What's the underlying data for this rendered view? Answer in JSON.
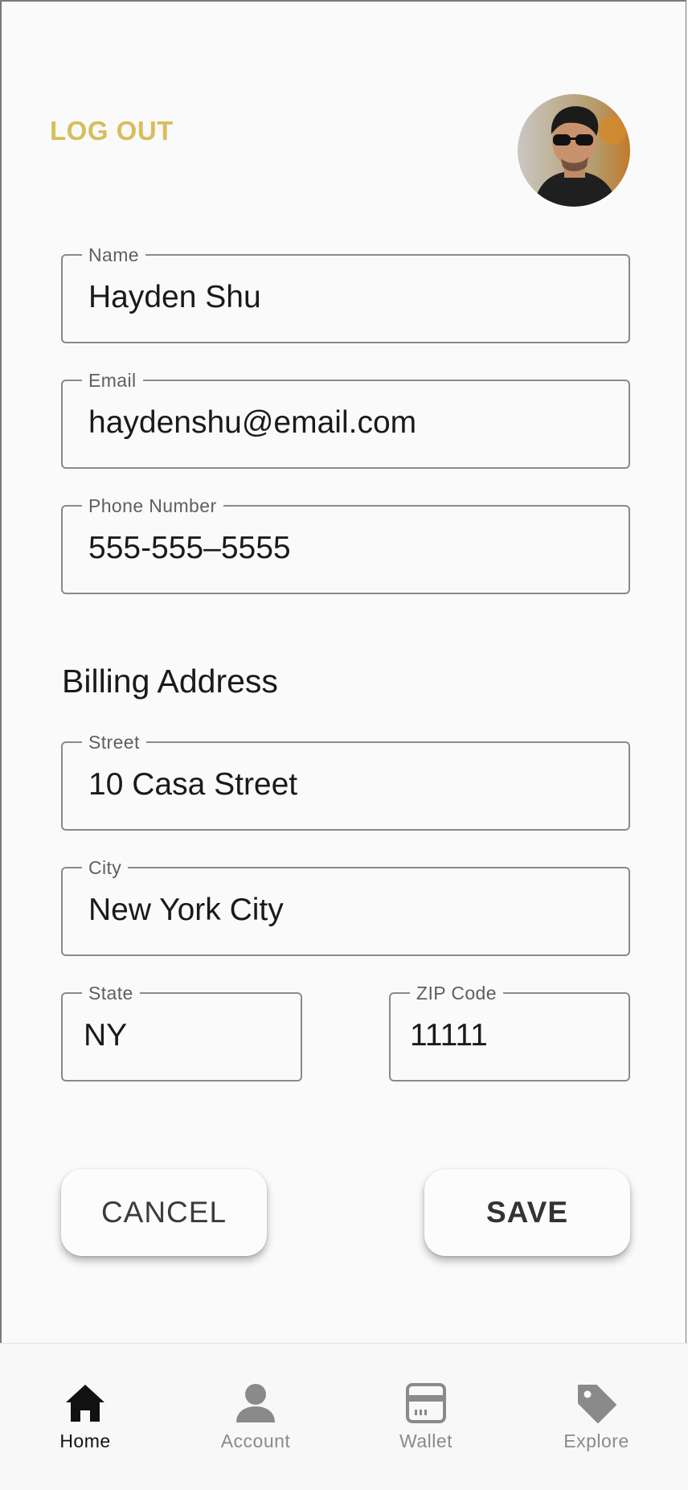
{
  "header": {
    "logout_label": "LOG OUT"
  },
  "profile": {
    "name": {
      "label": "Name",
      "value": "Hayden Shu"
    },
    "email": {
      "label": "Email",
      "value": "haydenshu@email.com"
    },
    "phone": {
      "label": "Phone Number",
      "value": "555-555–5555"
    }
  },
  "billing": {
    "title": "Billing Address",
    "street": {
      "label": "Street",
      "value": "10 Casa Street"
    },
    "city": {
      "label": "City",
      "value": "New York City"
    },
    "state": {
      "label": "State",
      "value": "NY"
    },
    "zip": {
      "label": "ZIP Code",
      "value": "11111"
    }
  },
  "actions": {
    "cancel_label": "CANCEL",
    "save_label": "SAVE"
  },
  "nav": {
    "items": [
      {
        "label": "Home",
        "icon": "home-icon",
        "active": true
      },
      {
        "label": "Account",
        "icon": "account-icon",
        "active": false
      },
      {
        "label": "Wallet",
        "icon": "wallet-icon",
        "active": false
      },
      {
        "label": "Explore",
        "icon": "tag-icon",
        "active": false
      }
    ]
  },
  "colors": {
    "accent": "#d8bd5c",
    "text": "#1a1a1a",
    "border": "#8a8a8a",
    "nav_inactive": "#8a8a8a",
    "nav_active": "#111111"
  }
}
